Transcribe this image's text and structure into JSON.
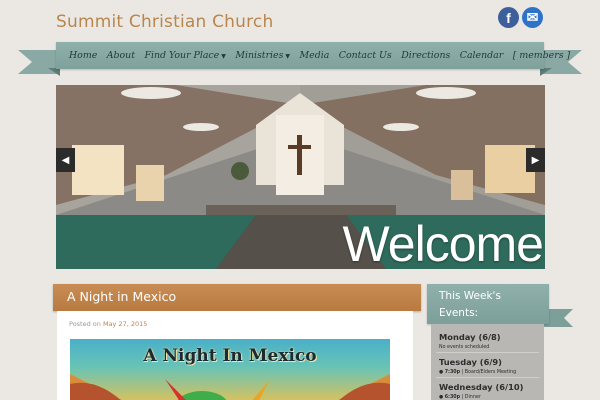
{
  "site": {
    "title": "Summit Christian Church"
  },
  "social": {
    "facebook_glyph": "f",
    "mail_glyph": "✉"
  },
  "nav": {
    "items": [
      {
        "label": "Home"
      },
      {
        "label": "About"
      },
      {
        "label": "Find Your Place",
        "dropdown": true
      },
      {
        "label": "Ministries",
        "dropdown": true
      },
      {
        "label": "Media"
      },
      {
        "label": "Contact Us"
      },
      {
        "label": "Directions"
      },
      {
        "label": "Calendar"
      },
      {
        "label": "[ members ]"
      }
    ]
  },
  "slider": {
    "caption": "Welcome",
    "prev_glyph": "◀",
    "next_glyph": "▶"
  },
  "post": {
    "title": "A Night in Mexico",
    "posted_prefix": "Posted on",
    "posted_date": "May 27, 2015",
    "image_title": "A Night In Mexico"
  },
  "events": {
    "title": "This Week's Events:",
    "days": [
      {
        "day": "Monday (6/8)",
        "items": [
          "No events scheduled"
        ]
      },
      {
        "day": "Tuesday (6/9)",
        "items": [
          {
            "time": "7:30p",
            "text": "Board/Elders Meeting"
          }
        ]
      },
      {
        "day": "Wednesday (6/10)",
        "items": [
          {
            "time": "6:30p",
            "text": "Dinner"
          }
        ]
      }
    ]
  },
  "colors": {
    "background": "#ebe8e3",
    "title_brown": "#b8864e",
    "ribbon_teal": "#8fb0ab",
    "post_header_orange": "#c88d55",
    "facebook_blue": "#3d5f9b",
    "mail_blue": "#2f73c9"
  }
}
